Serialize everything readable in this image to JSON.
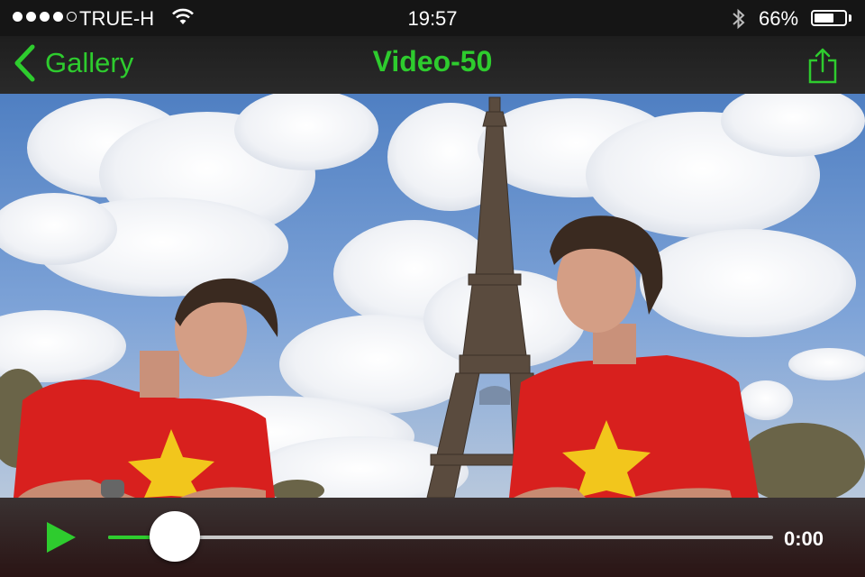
{
  "status_bar": {
    "carrier": "TRUE-H",
    "time": "19:57",
    "battery_percent": "66%",
    "battery_level": 0.66,
    "signal_bars_filled": 4,
    "signal_bars_total": 5,
    "icons": [
      "signal-dots",
      "wifi-icon",
      "bluetooth-icon",
      "battery-icon"
    ]
  },
  "nav": {
    "back_label": "Gallery",
    "title": "Video-50",
    "icons": [
      "chevron-left-icon",
      "share-icon"
    ]
  },
  "video": {
    "description_icons": [
      "eiffel-tower",
      "person-left",
      "person-right"
    ]
  },
  "player": {
    "time": "0:00",
    "progress": 0.1,
    "icons": [
      "play-icon"
    ]
  },
  "colors": {
    "accent": "#2ecc2e",
    "status_bg": "#151515",
    "nav_bg": "#222222",
    "controls_bg": "#2a1414",
    "shirt": "#d8201e",
    "star": "#f2c61c"
  }
}
